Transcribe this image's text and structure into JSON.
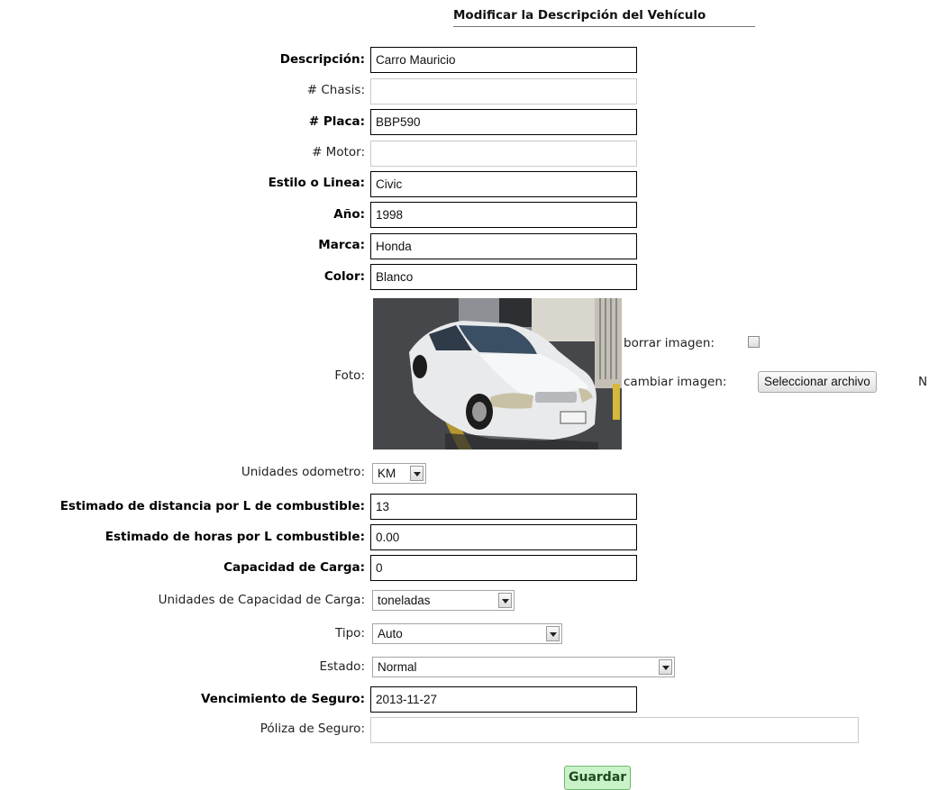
{
  "title": "Modificar la Descripción del Vehículo",
  "fields": {
    "descripcion": {
      "label": "Descripción:",
      "value": "Carro Mauricio"
    },
    "chasis": {
      "label": "# Chasis:",
      "value": ""
    },
    "placa": {
      "label": "# Placa:",
      "value": "BBP590"
    },
    "motor": {
      "label": "# Motor:",
      "value": ""
    },
    "estilo": {
      "label": "Estilo o Linea:",
      "value": "Civic"
    },
    "anio": {
      "label": "Año:",
      "value": "1998"
    },
    "marca": {
      "label": "Marca:",
      "value": "Honda"
    },
    "color": {
      "label": "Color:",
      "value": "Blanco"
    },
    "foto": {
      "label": "Foto:"
    },
    "borrar_imagen": {
      "label": "borrar imagen:"
    },
    "cambiar_imagen": {
      "label": "cambiar imagen:",
      "button": "Seleccionar archivo",
      "trailing": "N"
    },
    "unidades_odometro": {
      "label": "Unidades odometro:",
      "value": "KM"
    },
    "estimado_distancia": {
      "label": "Estimado de distancia por L de combustible:",
      "value": "13"
    },
    "estimado_horas": {
      "label": "Estimado de horas por L combustible:",
      "value": "0.00"
    },
    "capacidad_carga": {
      "label": "Capacidad de Carga:",
      "value": "0"
    },
    "unidades_capacidad": {
      "label": "Unidades de Capacidad de Carga:",
      "value": "toneladas"
    },
    "tipo": {
      "label": "Tipo:",
      "value": "Auto"
    },
    "estado": {
      "label": "Estado:",
      "value": "Normal"
    },
    "vencimiento_seguro": {
      "label": "Vencimiento de Seguro:",
      "value": "2013-11-27"
    },
    "poliza_seguro": {
      "label": "Póliza de Seguro:",
      "value": ""
    }
  },
  "save_button": "Guardar",
  "icons": {
    "select_arrow": "chevron-down-icon",
    "photo": "car-photo"
  }
}
